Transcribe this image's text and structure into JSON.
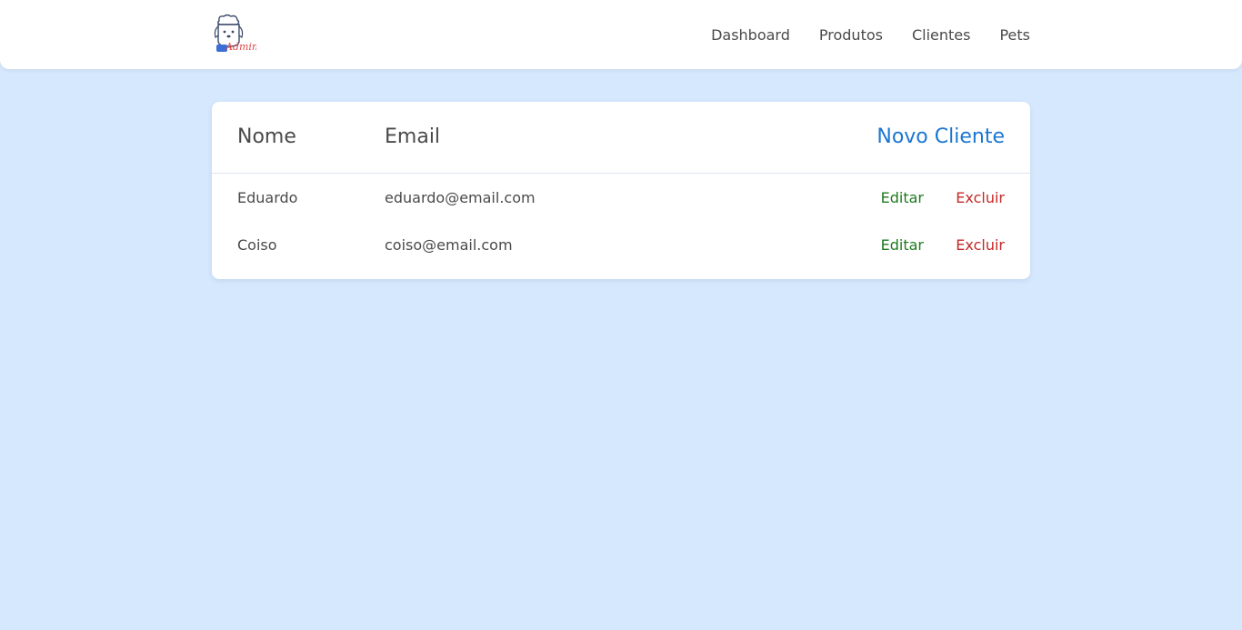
{
  "brand": {
    "logo_text": "Admin"
  },
  "nav": {
    "items": [
      {
        "label": "Dashboard"
      },
      {
        "label": "Produtos"
      },
      {
        "label": "Clientes"
      },
      {
        "label": "Pets"
      }
    ]
  },
  "table": {
    "headers": {
      "nome": "Nome",
      "email": "Email"
    },
    "new_button": "Novo Cliente",
    "rows": [
      {
        "nome": "Eduardo",
        "email": "eduardo@email.com",
        "edit_label": "Editar",
        "delete_label": "Excluir"
      },
      {
        "nome": "Coiso",
        "email": "coiso@email.com",
        "edit_label": "Editar",
        "delete_label": "Excluir"
      }
    ]
  },
  "colors": {
    "background": "#d6e8fd",
    "accent": "#1b76d2",
    "edit": "#1f7a1f",
    "delete": "#c62828"
  }
}
